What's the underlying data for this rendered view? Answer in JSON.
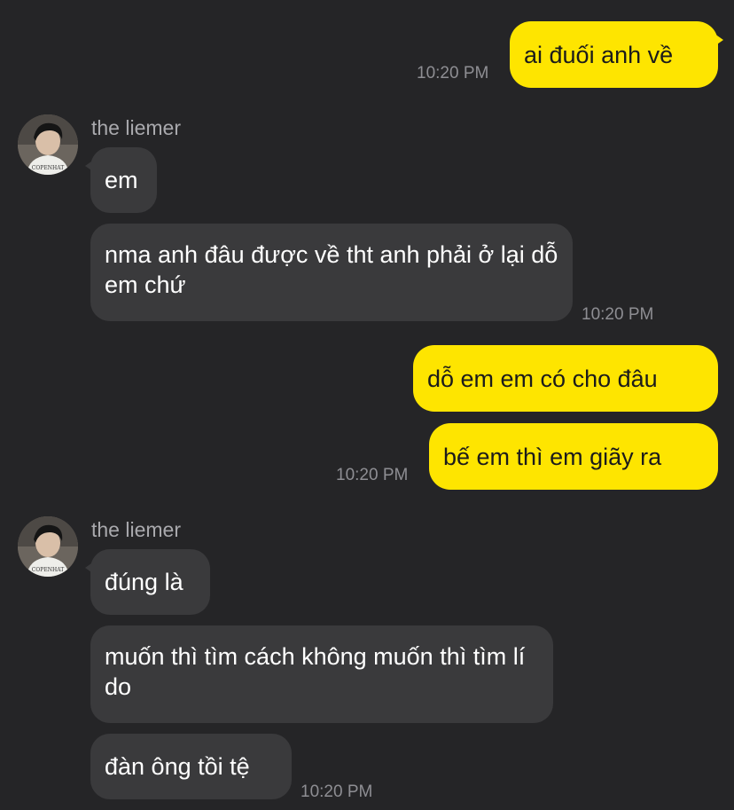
{
  "conversation": {
    "contact_name": "the liemer",
    "messages": [
      {
        "direction": "sent",
        "text": "ai đuối anh về",
        "time": "10:20 PM"
      },
      {
        "direction": "received",
        "text": "em"
      },
      {
        "direction": "received",
        "text": "nma anh đâu được về tht anh phải ở lại dỗ em chứ",
        "time": "10:20 PM"
      },
      {
        "direction": "sent",
        "text": "dỗ em em có cho đâu"
      },
      {
        "direction": "sent",
        "text": "bế em thì em giãy ra",
        "time": "10:20 PM"
      },
      {
        "direction": "received",
        "text": "đúng là"
      },
      {
        "direction": "received",
        "text": "muốn thì tìm cách không muốn thì tìm lí do"
      },
      {
        "direction": "received",
        "text": "đàn ông tồi tệ",
        "time": "10:20 PM"
      }
    ]
  },
  "avatar_shirt_text": "COPENHAT",
  "colors": {
    "background": "#252527",
    "sent_bubble": "#FEE500",
    "received_bubble": "#3a3a3c",
    "timestamp": "#8e8e93",
    "sender_name": "#a9a9ad"
  }
}
